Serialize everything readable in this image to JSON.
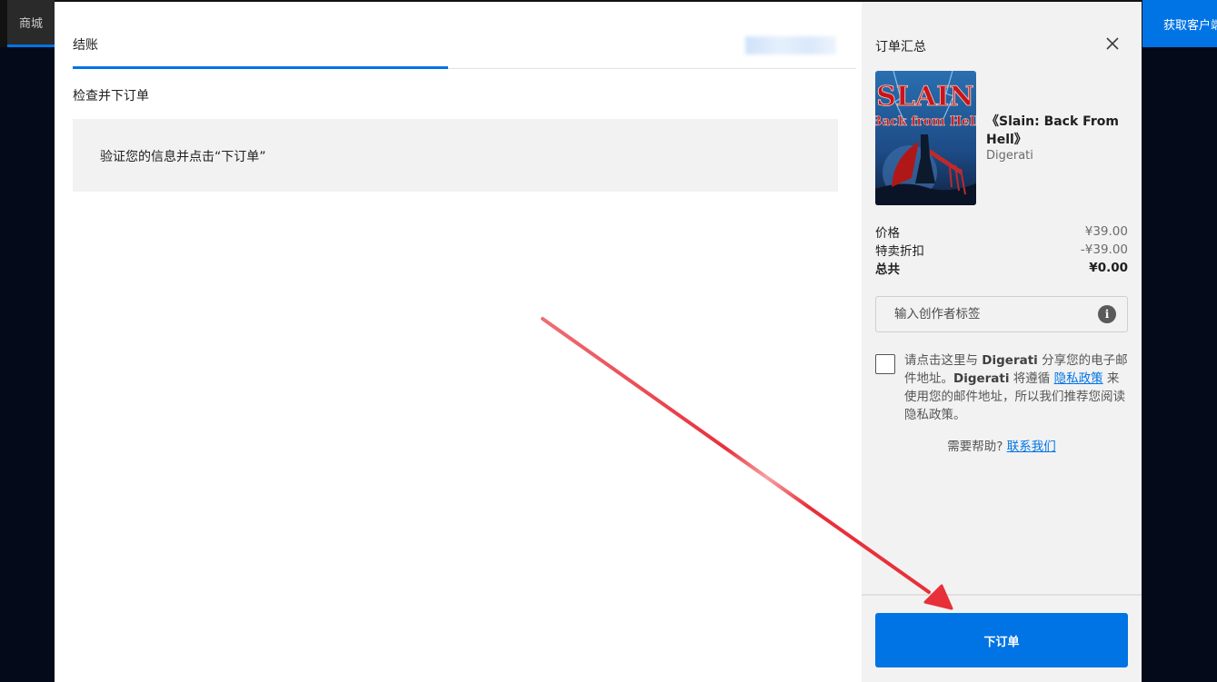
{
  "background": {
    "store_tab": "商城",
    "client_button": "获取客户端"
  },
  "checkout": {
    "tab_label": "结账",
    "section_title": "检查并下订单",
    "info_text": "验证您的信息并点击“下订单”"
  },
  "summary": {
    "title": "订单汇总",
    "game": {
      "title": "《Slain: Back From Hell》",
      "publisher": "Digerati",
      "cover_title_line1": "SLAIN",
      "cover_title_line2": "Back from Hell"
    },
    "price_rows": [
      {
        "label": "价格",
        "value": "¥39.00"
      },
      {
        "label": "特卖折扣",
        "value": "-¥39.00"
      },
      {
        "label": "总共",
        "value": "¥0.00"
      }
    ],
    "creator_placeholder": "输入创作者标签",
    "consent": {
      "part1": "请点击这里与 ",
      "brand1": "Digerati",
      "part2": " 分享您的电子邮件地址。",
      "brand2": "Digerati",
      "part3": " 将遵循 ",
      "privacy_link": "隐私政策",
      "part4": " 来使用您的邮件地址，所以我们推荐您阅读隐私政策。"
    },
    "help_text": "需要帮助? ",
    "help_link": "联系我们",
    "place_order": "下订单"
  },
  "colors": {
    "accent": "#0074e4",
    "annotation_arrow": "#e8303a"
  }
}
